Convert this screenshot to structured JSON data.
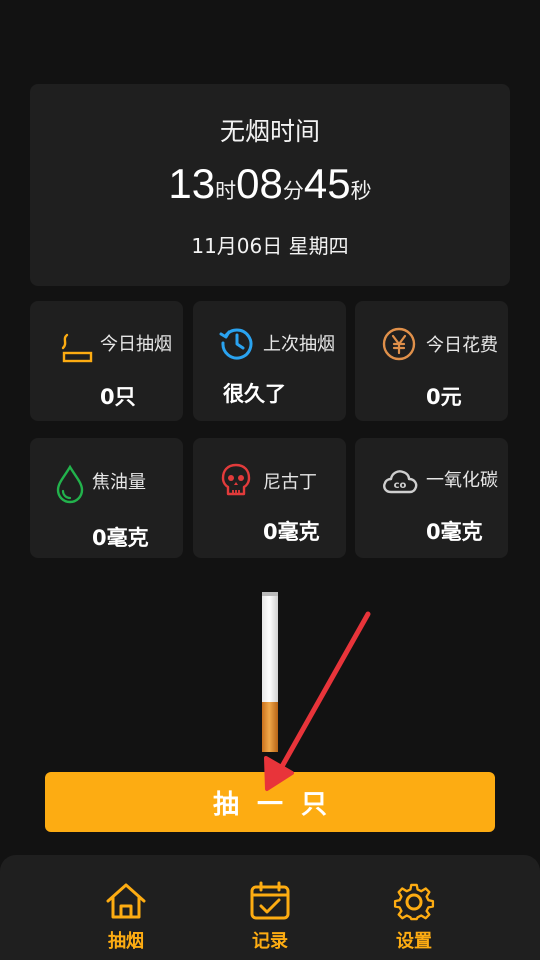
{
  "timer": {
    "title": "无烟时间",
    "hours": "13",
    "hours_unit": "时",
    "minutes": "08",
    "minutes_unit": "分",
    "seconds": "45",
    "seconds_unit": "秒",
    "date": "11月06日 星期四"
  },
  "stats": [
    {
      "label": "今日抽烟",
      "value": "0只",
      "icon": "cigarette-icon",
      "color": "#fdac12"
    },
    {
      "label": "上次抽烟",
      "value": "很久了",
      "icon": "history-icon",
      "color": "#2aa3f0"
    },
    {
      "label": "今日花费",
      "value": "0元",
      "icon": "yuan-coin-icon",
      "color": "#e0904a"
    },
    {
      "label": "焦油量",
      "value": "0毫克",
      "icon": "drop-icon",
      "color": "#22b24c"
    },
    {
      "label": "尼古丁",
      "value": "0毫克",
      "icon": "skull-icon",
      "color": "#e23b3b"
    },
    {
      "label": "一氧化碳",
      "value": "0毫克",
      "icon": "co-cloud-icon",
      "color": "#cfcfcf"
    }
  ],
  "action": {
    "smoke_label": "抽一只",
    "color": "#fdac12"
  },
  "nav": [
    {
      "label": "抽烟",
      "icon": "home-icon"
    },
    {
      "label": "记录",
      "icon": "calendar-check-icon"
    },
    {
      "label": "设置",
      "icon": "gear-icon"
    }
  ]
}
